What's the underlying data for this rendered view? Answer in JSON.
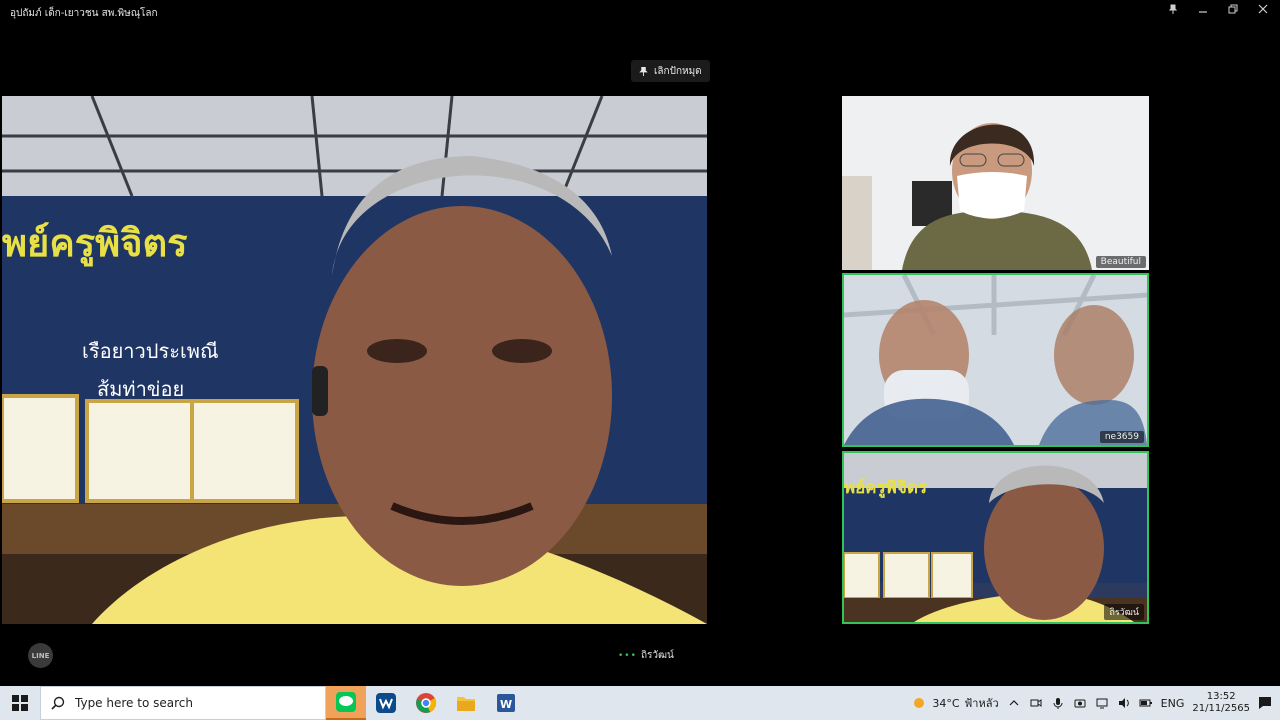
{
  "window": {
    "title": "อุปถัมภ์ เด็ก-เยาวชน สพ.พิษณุโลก",
    "controls": [
      "pin-icon",
      "minimize-icon",
      "restore-icon",
      "close-icon"
    ]
  },
  "meeting": {
    "pin_badge_label": "เลิกปักหมุด",
    "main_speaker_name": "ถิรวัฒน์",
    "tiles": [
      {
        "name": "Beautiful",
        "icon": "user-icon"
      },
      {
        "name": "ne3659",
        "icon": "user-icon"
      },
      {
        "name": "ถิรวัฒน์",
        "icon": "user-icon"
      }
    ],
    "banner_text": "พย์ครูพิจิตร",
    "banner_sub": [
      "เรือยาวประเพณี",
      "ส้มท่าข่อย"
    ],
    "active_color": "#33c35a"
  },
  "line_logo": "LINE",
  "taskbar": {
    "search_placeholder": "Type here to search",
    "apps": [
      "line-app-icon",
      "webex-icon",
      "chrome-icon",
      "file-explorer-icon",
      "word-icon"
    ],
    "weather_temp": "34°C",
    "weather_text": "ฟ้าหลัว",
    "language": "ENG",
    "time": "13:52",
    "date": "21/11/2565"
  }
}
